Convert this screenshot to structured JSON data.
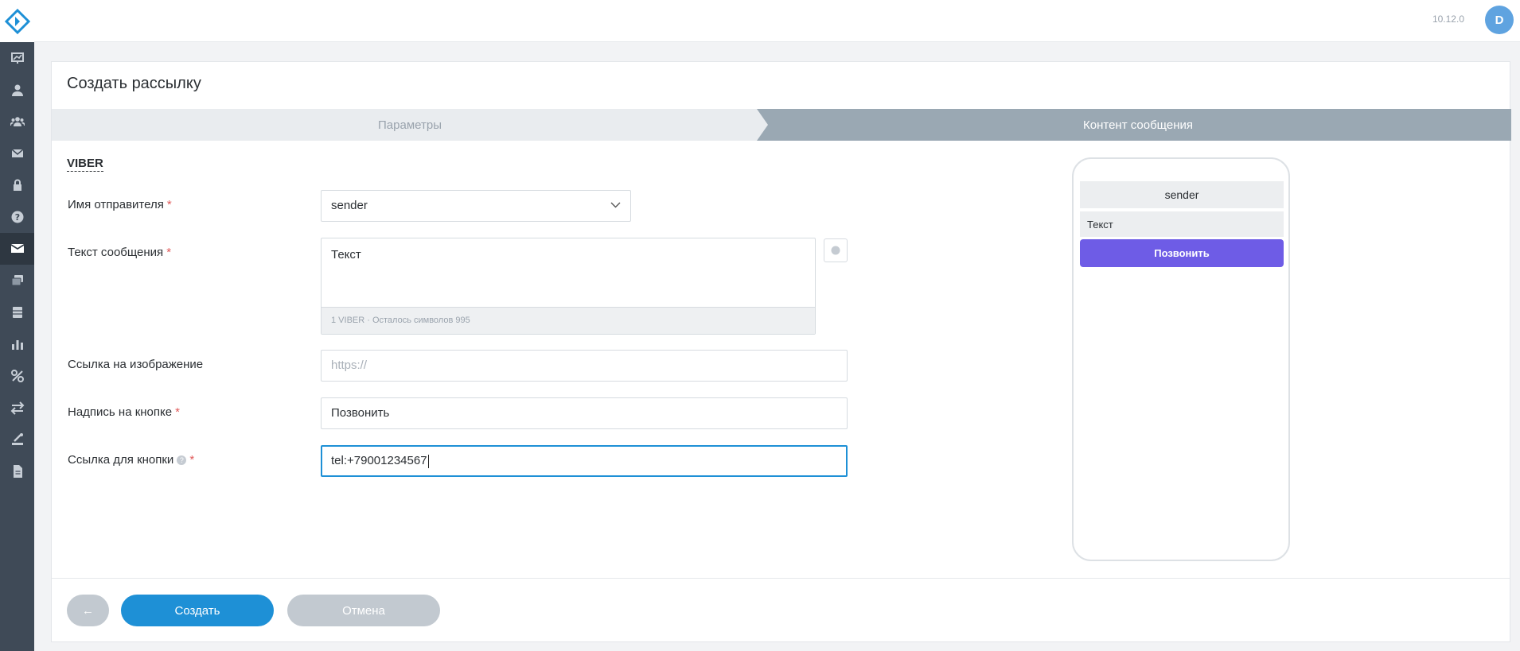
{
  "app": {
    "version": "10.12.0",
    "user_initial": "D",
    "colors": {
      "accent": "#1e90d6",
      "preview_button": "#6e5ce6",
      "sidebar": "#3f4a57"
    }
  },
  "sidebar": {
    "items": [
      {
        "icon": "dashboard-icon"
      },
      {
        "icon": "user-icon"
      },
      {
        "icon": "users-group-icon"
      },
      {
        "icon": "mail-icon"
      },
      {
        "icon": "lock-icon"
      },
      {
        "icon": "help-icon"
      },
      {
        "icon": "campaigns-icon",
        "active": true
      },
      {
        "icon": "layers-icon"
      },
      {
        "icon": "database-icon"
      },
      {
        "icon": "bar-chart-icon"
      },
      {
        "icon": "integrations-icon"
      },
      {
        "icon": "exchange-icon"
      },
      {
        "icon": "tools-icon"
      },
      {
        "icon": "document-icon"
      }
    ]
  },
  "page": {
    "title": "Создать рассылку",
    "steps": [
      "Параметры",
      "Контент сообщения"
    ],
    "section": "VIBER"
  },
  "form": {
    "sender_label": "Имя отправителя",
    "sender_value": "sender",
    "message_label": "Текст сообщения",
    "message_value": "Текст",
    "message_counter": "1 VIBER · Осталось символов 995",
    "image_label": "Ссылка на изображение",
    "image_placeholder": "https://",
    "button_text_label": "Надпись на кнопке",
    "button_text_value": "Позвонить",
    "button_link_label": "Ссылка для кнопки",
    "button_link_value": "tel:+79001234567",
    "required_mark": "*",
    "help_mark": "?"
  },
  "preview": {
    "sender": "sender",
    "text": "Текст",
    "button": "Позвонить"
  },
  "footer": {
    "back": "←",
    "create": "Создать",
    "cancel": "Отмена"
  }
}
